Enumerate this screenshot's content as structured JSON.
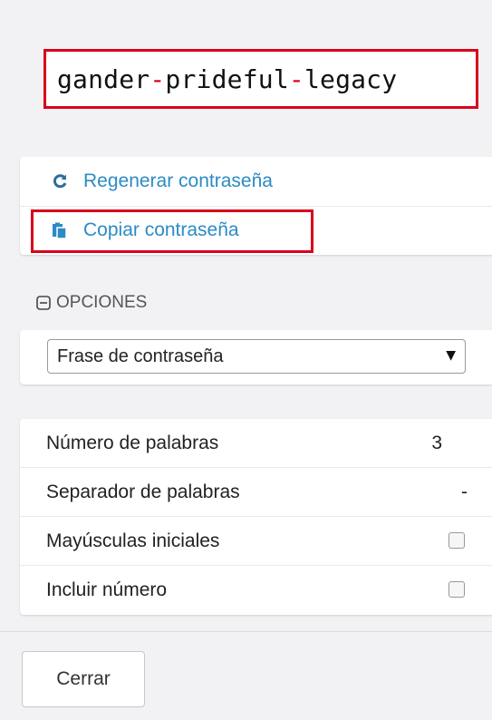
{
  "password": {
    "word1": "gander",
    "sep1": "-",
    "word2": "prideful",
    "sep2": "-",
    "word3": "legacy"
  },
  "actions": {
    "regenerate_label": "Regenerar contraseña",
    "copy_label": "Copiar contraseña"
  },
  "options": {
    "header": "OPCIONES",
    "type_selected": "Frase de contraseña",
    "settings": [
      {
        "label": "Número de palabras",
        "value": "3"
      },
      {
        "label": "Separador de palabras",
        "value": "-"
      },
      {
        "label": "Mayúsculas iniciales",
        "checked": false
      },
      {
        "label": "Incluir número",
        "checked": false
      }
    ]
  },
  "footer": {
    "close_label": "Cerrar"
  },
  "colors": {
    "accent": "#2b8bc6",
    "highlight": "#d9001b"
  },
  "icons": {
    "regenerate": "refresh-icon",
    "copy": "clipboard-icon",
    "collapse": "minus-square-icon",
    "dropdown": "triangle-down-icon"
  }
}
